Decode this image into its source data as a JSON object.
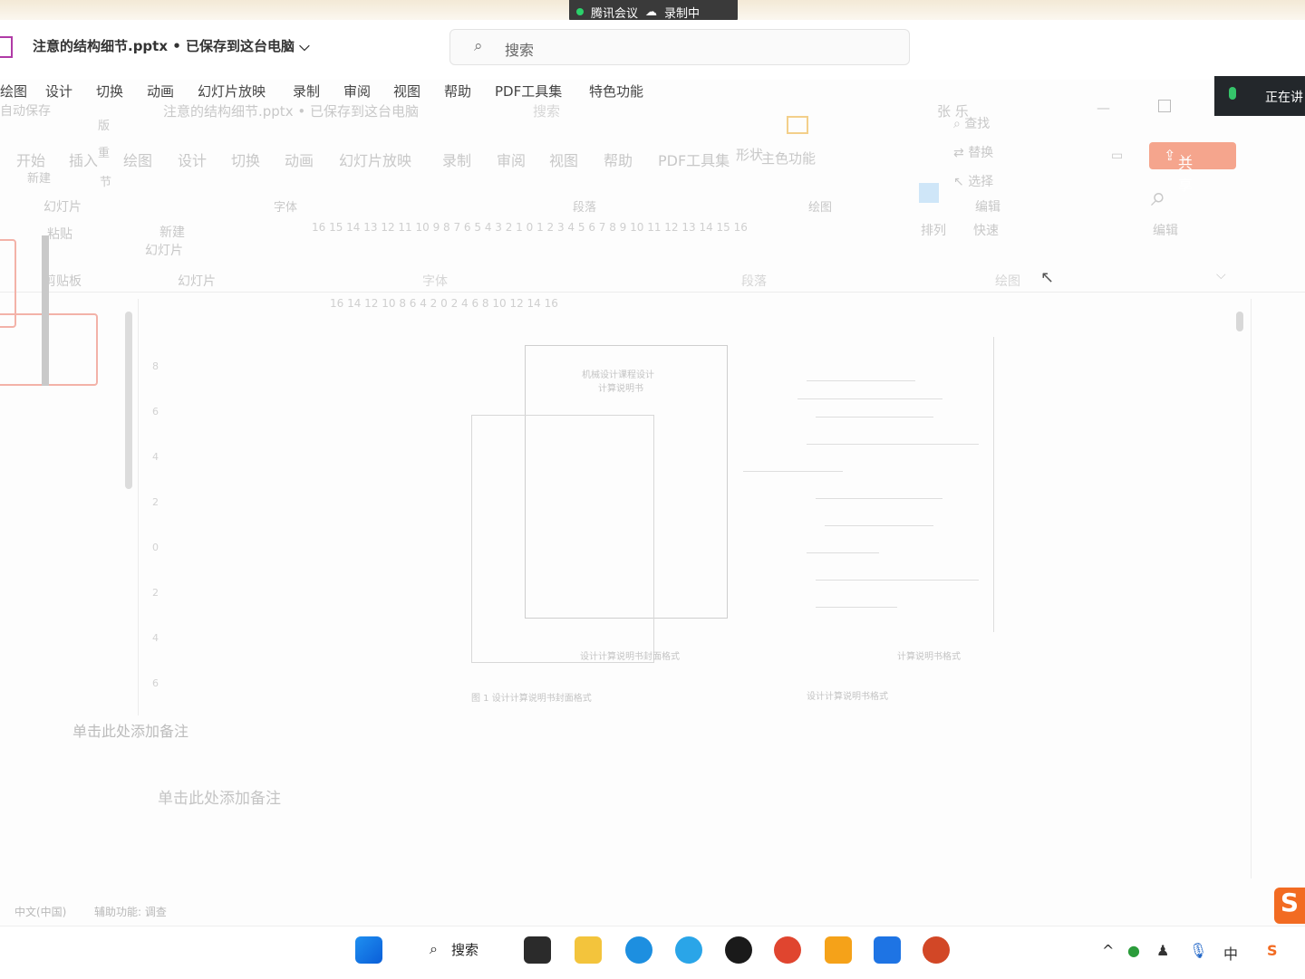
{
  "meeting": {
    "app": "腾讯会议",
    "recording": "录制中"
  },
  "window": {
    "doc_title": "注意的结构细节.pptx • 已保存到这台电脑",
    "doc_title_ghost": "注意的结构细节.pptx • 已保存到这台电脑",
    "autosave": "自动保存"
  },
  "search": {
    "placeholder": "搜索",
    "ghost": "搜索"
  },
  "ribbon": {
    "tabs": [
      "绘图",
      "设计",
      "切换",
      "动画",
      "幻灯片放映",
      "录制",
      "审阅",
      "视图",
      "帮助",
      "PDF工具集",
      "特色功能"
    ],
    "ghost_tabs": [
      "开始",
      "插入",
      "绘图",
      "设计",
      "切换",
      "动画",
      "幻灯片放映",
      "录制",
      "审阅",
      "视图",
      "帮助",
      "PDF工具集"
    ],
    "groups": {
      "clipboard": "剪贴板",
      "slides": "幻灯片",
      "font": "字体",
      "paragraph": "段落",
      "drawing": "绘图",
      "font2": "字体",
      "paragraph2": "段落",
      "drawing2": "绘图"
    },
    "buttons": {
      "paste": "粘贴",
      "new_slide": "新建幻灯片",
      "new_slide2": "新建",
      "slide_label": "幻灯片",
      "layout": "版",
      "reset": "重",
      "section": "节",
      "find": "查找",
      "replace": "替换",
      "select": "选择",
      "edit": "编辑",
      "arrange": "排列",
      "quick_style": "快速",
      "shape_fill": "形状",
      "theme_color": "主色功能",
      "edit_ghost": "编辑"
    },
    "user": "张 乐",
    "share": "共享"
  },
  "speaking": "正在讲",
  "rulers": {
    "top1": "16 15 14 13 12 11 10  9  8  7  6  5  4  3  2  1  0  1  2  3  4  5  6  7  8  9 10 11 12 13 14 15 16",
    "top2": "16    14    12    10     8     6     4     2     0     2     4     6     8    10    12    14    16",
    "left": [
      "8",
      "6",
      "4",
      "2",
      "0",
      "2",
      "4",
      "6"
    ]
  },
  "slide": {
    "title1": "机械设计课程设计",
    "title2": "计算说明书",
    "caption_left": "图 1  设计计算说明书封面格式",
    "caption_right": "设计计算说明书格式",
    "left_cap2": "设计计算说明书封面格式",
    "bottom_label": "计算说明书格式"
  },
  "notes": {
    "placeholder1": "单击此处添加备注",
    "placeholder2": "单击此处添加备注"
  },
  "status": {
    "language": "中文(中国)",
    "accessibility": "辅助功能: 调查"
  },
  "taskbar": {
    "search": "搜索",
    "ime": "中"
  },
  "colors": {
    "accent_ppt": "#c43e1c",
    "share": "#f5a58d",
    "speaking_bg": "#23272b"
  }
}
